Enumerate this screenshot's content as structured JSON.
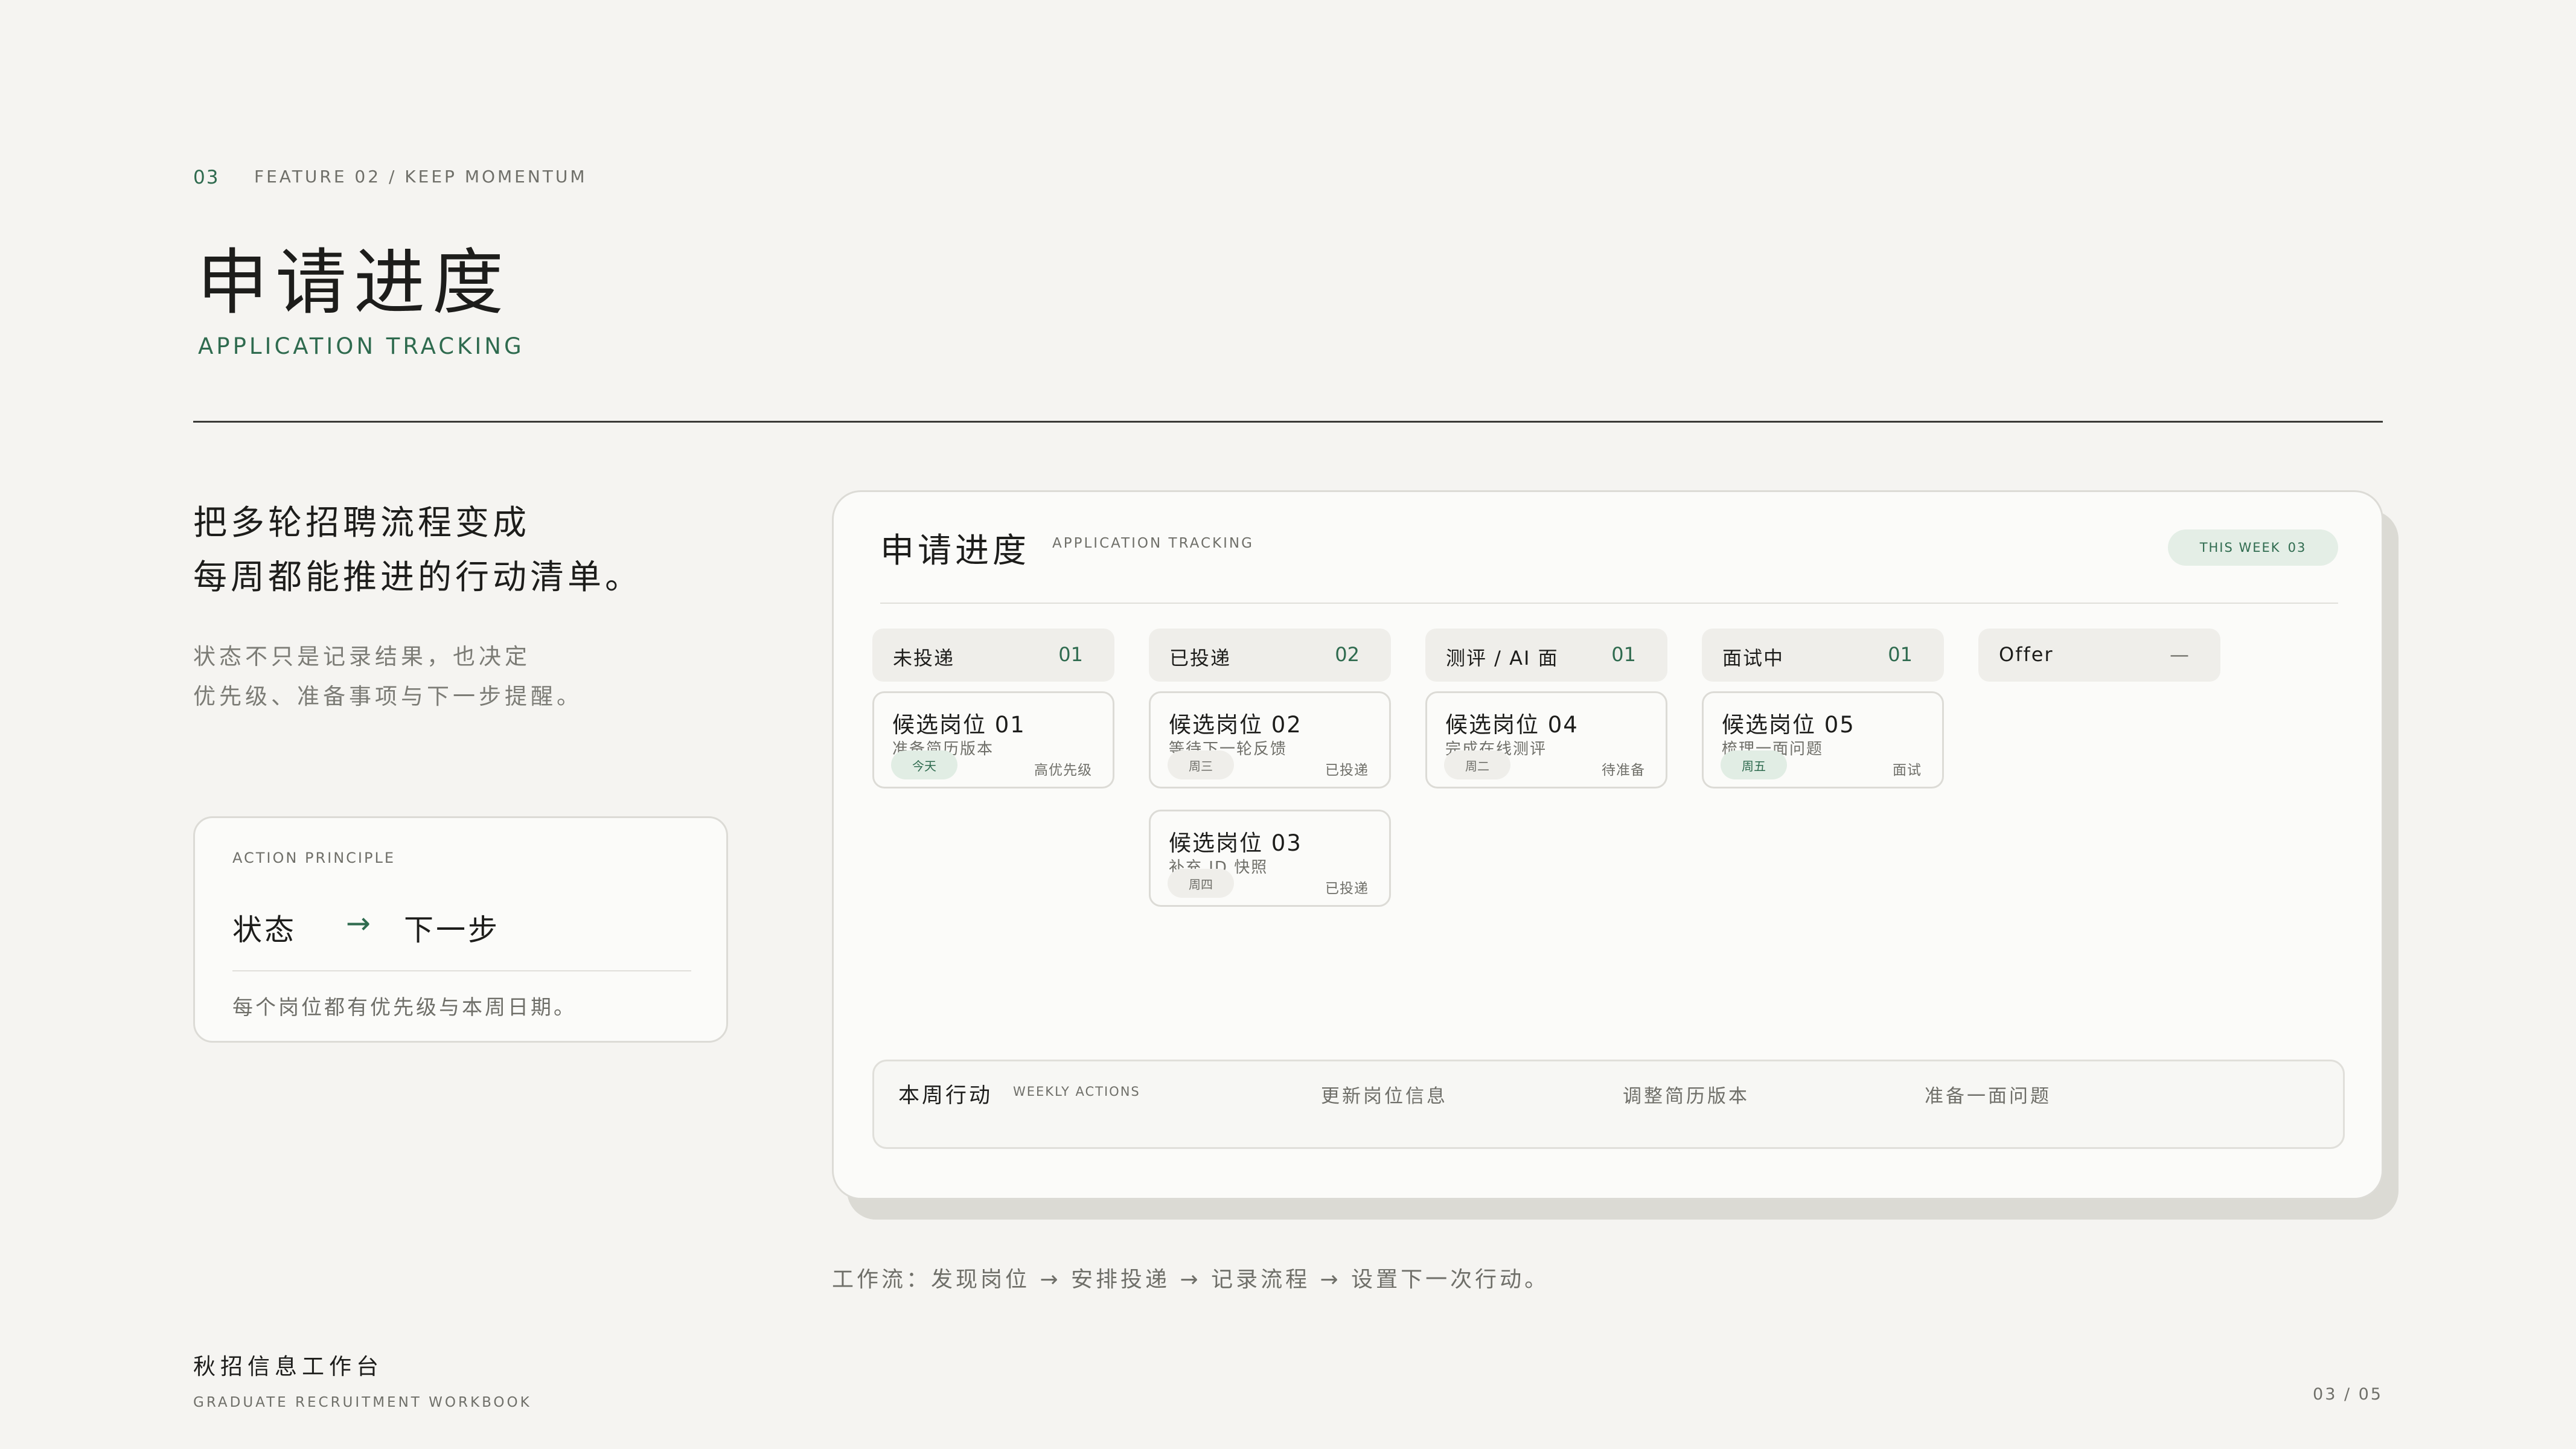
{
  "header": {
    "section_number": "03",
    "section_tag": "FEATURE 02 / KEEP MOMENTUM",
    "title": "申请进度",
    "subtitle": "APPLICATION TRACKING"
  },
  "intro": {
    "lead_lines": [
      "把多轮招聘流程变成",
      "每周都能推进的行动清单。"
    ],
    "desc_lines": [
      "状态不只是记录结果，也决定",
      "优先级、准备事项与下一步提醒。"
    ]
  },
  "principle": {
    "label": "ACTION PRINCIPLE",
    "state": "状态",
    "arrow": "→",
    "next": "下一步",
    "note": "每个岗位都有优先级与本周日期。"
  },
  "panel": {
    "title": "申请进度",
    "subtitle": "APPLICATION TRACKING",
    "week_label": "THIS WEEK",
    "week_count": "03",
    "columns": [
      {
        "name": "未投递",
        "count": "01",
        "cards": [
          {
            "title": "候选岗位 01",
            "note": "准备简历版本",
            "tag": "今天",
            "status": "高优先级",
            "hot": true
          }
        ]
      },
      {
        "name": "已投递",
        "count": "02",
        "cards": [
          {
            "title": "候选岗位 02",
            "note": "等待下一轮反馈",
            "tag": "周三",
            "status": "已投递",
            "hot": false
          },
          {
            "title": "候选岗位 03",
            "note": "补充 JD 快照",
            "tag": "周四",
            "status": "已投递",
            "hot": false
          }
        ]
      },
      {
        "name": "测评 / AI 面",
        "count": "01",
        "cards": [
          {
            "title": "候选岗位 04",
            "note": "完成在线测评",
            "tag": "周二",
            "status": "待准备",
            "hot": false
          }
        ]
      },
      {
        "name": "面试中",
        "count": "01",
        "cards": [
          {
            "title": "候选岗位 05",
            "note": "梳理一面问题",
            "tag": "周五",
            "status": "面试",
            "hot": true
          }
        ]
      },
      {
        "name": "Offer",
        "count": "—",
        "cards": []
      }
    ],
    "weekly": {
      "title": "本周行动",
      "subtitle": "WEEKLY ACTIONS",
      "items": [
        "更新岗位信息",
        "调整简历版本",
        "准备一面问题"
      ]
    }
  },
  "workflow": "工作流：发现岗位 → 安排投递 → 记录流程 → 设置下一次行动。",
  "footer": {
    "title": "秋招信息工作台",
    "subtitle": "GRADUATE RECRUITMENT WORKBOOK",
    "page": "03 / 05"
  },
  "colors": {
    "background": "#f5f4f1",
    "accent": "#2f6b4f",
    "text": "#1d1d1b",
    "muted": "#6f6f69"
  }
}
